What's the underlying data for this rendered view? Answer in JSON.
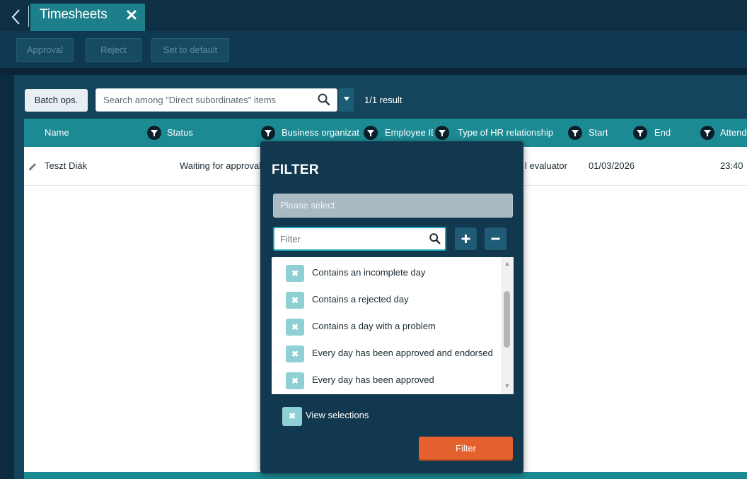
{
  "header": {
    "tab_title": "Timesheets"
  },
  "toolbar": {
    "approval": "Approval",
    "reject": "Reject",
    "set_default": "Set to default"
  },
  "controls": {
    "batch_ops": "Batch ops.",
    "search_placeholder": "Search among \"Direct subordinates\" items",
    "result_count": "1/1 result"
  },
  "table": {
    "columns": [
      "Name",
      "Status",
      "Business organizat",
      "Employee ID",
      "Type of HR relationship",
      "Start",
      "End",
      "Attendance"
    ],
    "rows": [
      {
        "name": "Teszt Diák",
        "status": "Waiting for approval",
        "hr_type": "l evaluator",
        "start": "01/03/2026",
        "end": "",
        "attendance": "23:40"
      }
    ]
  },
  "filter_popup": {
    "title": "FILTER",
    "select_placeholder": "Please select.",
    "filter_placeholder": "Filter",
    "options": [
      "Contains an incomplete day",
      "Contains a rejected day",
      "Contains a day with a problem",
      "Every day has been approved and endorsed",
      "Every day has been approved"
    ],
    "view_selections": "View selections",
    "filter_button": "Filter"
  },
  "colors": {
    "header_teal": "#1c8a93",
    "dark_navy": "#0d2b3e",
    "popup_bg": "#12384f",
    "filter_orange": "#e4602c",
    "check_teal": "#8fd0d4"
  }
}
